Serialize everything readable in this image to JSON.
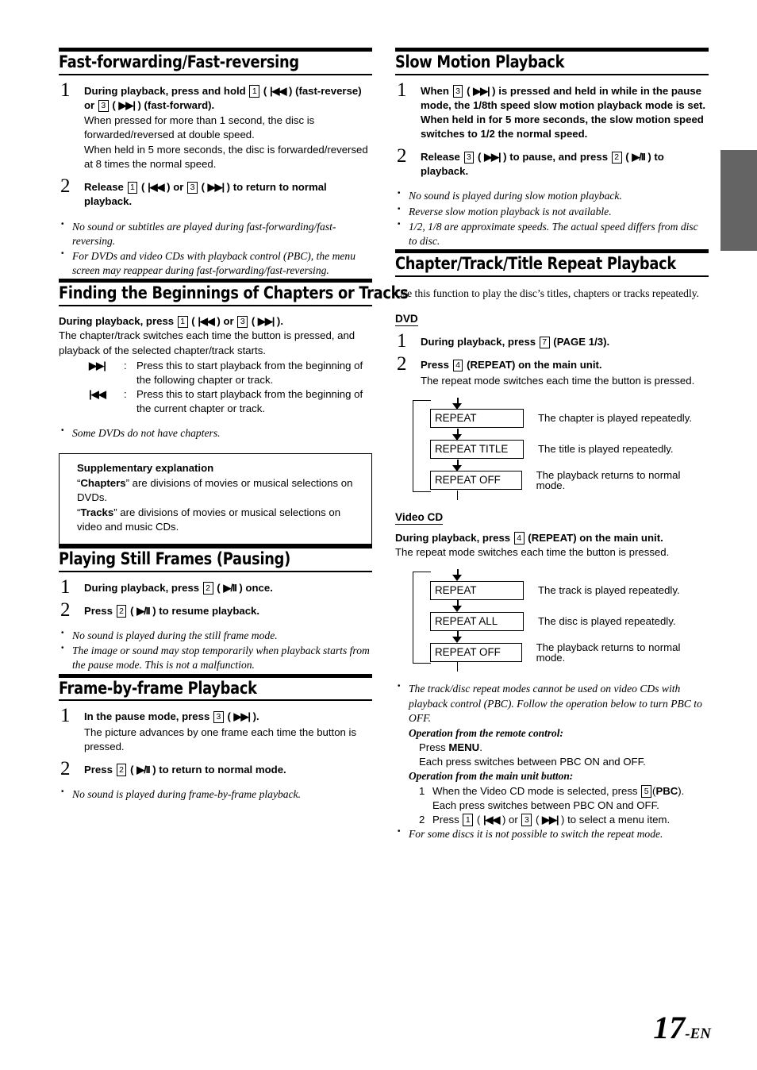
{
  "page": {
    "number_main": "17",
    "number_suffix": "-EN",
    "thumb_tab_color": "#646464"
  },
  "symbols": {
    "prev": "|◀◀",
    "next": "▶▶|",
    "play_pause": "▶/II"
  },
  "left_column": {
    "sections": [
      {
        "id": "fast-forwarding",
        "title": "Fast-forwarding/Fast-reversing",
        "steps": [
          {
            "num": "1",
            "lead_parts": [
              {
                "t": "text",
                "v": "During playback, press and hold "
              },
              {
                "t": "key",
                "v": "1"
              },
              {
                "t": "text",
                "v": " ( "
              },
              {
                "t": "sym",
                "v": "|◀◀"
              },
              {
                "t": "text",
                "v": " ) (fast-reverse) or "
              },
              {
                "t": "key",
                "v": "3"
              },
              {
                "t": "text",
                "v": " ( "
              },
              {
                "t": "sym",
                "v": "▶▶|"
              },
              {
                "t": "text",
                "v": " ) (fast-forward)."
              }
            ],
            "sub": [
              "When pressed for more than 1 second, the disc is forwarded/reversed at double speed.",
              "When held in 5 more seconds, the disc is forwarded/reversed at 8 times the normal speed."
            ]
          },
          {
            "num": "2",
            "lead_parts": [
              {
                "t": "text",
                "v": "Release "
              },
              {
                "t": "key",
                "v": "1"
              },
              {
                "t": "text",
                "v": " ( "
              },
              {
                "t": "sym",
                "v": "|◀◀"
              },
              {
                "t": "text",
                "v": " ) or "
              },
              {
                "t": "key",
                "v": "3"
              },
              {
                "t": "text",
                "v": " ( "
              },
              {
                "t": "sym",
                "v": "▶▶|"
              },
              {
                "t": "text",
                "v": " ) to return to normal playback."
              }
            ],
            "sub": []
          }
        ],
        "notes": [
          "No sound or subtitles are played during fast-forwarding/fast-reversing.",
          "For DVDs and video CDs with playback control (PBC), the menu screen may reappear during fast-forwarding/fast-reversing."
        ]
      },
      {
        "id": "finding-beginnings",
        "title": "Finding the Beginnings of Chapters or Tracks",
        "instruction_parts": [
          {
            "t": "text",
            "v": "During playback, press "
          },
          {
            "t": "key",
            "v": "1"
          },
          {
            "t": "text",
            "v": " ( "
          },
          {
            "t": "sym",
            "v": "|◀◀"
          },
          {
            "t": "text",
            "v": " ) or "
          },
          {
            "t": "key",
            "v": "3"
          },
          {
            "t": "text",
            "v": " ( "
          },
          {
            "t": "sym",
            "v": "▶▶|"
          },
          {
            "t": "text",
            "v": " )."
          }
        ],
        "body": "The chapter/track switches each time the button is pressed, and playback of the selected chapter/track starts.",
        "symbol_rows": [
          {
            "symbol": "▶▶|",
            "desc": "Press this to start playback from the beginning of the following chapter or track."
          },
          {
            "symbol": "|◀◀",
            "desc": "Press this to start playback from the beginning of the current chapter or track."
          }
        ],
        "notes": [
          "Some DVDs do not have chapters."
        ],
        "supplementary": {
          "title": "Supplementary explanation",
          "lines": [
            [
              {
                "t": "text",
                "v": "“"
              },
              {
                "t": "b",
                "v": "Chapters"
              },
              {
                "t": "text",
                "v": "” are divisions of movies or musical selections on DVDs."
              }
            ],
            [
              {
                "t": "text",
                "v": "“"
              },
              {
                "t": "b",
                "v": "Tracks"
              },
              {
                "t": "text",
                "v": "” are divisions of movies or musical selections on video and music CDs."
              }
            ]
          ]
        }
      },
      {
        "id": "still-frames",
        "title": "Playing Still Frames (Pausing)",
        "steps": [
          {
            "num": "1",
            "lead_parts": [
              {
                "t": "text",
                "v": "During playback, press "
              },
              {
                "t": "key",
                "v": "2"
              },
              {
                "t": "text",
                "v": " ( "
              },
              {
                "t": "sym",
                "v": "▶/II"
              },
              {
                "t": "text",
                "v": " ) once."
              }
            ],
            "sub": []
          },
          {
            "num": "2",
            "lead_parts": [
              {
                "t": "text",
                "v": "Press "
              },
              {
                "t": "key",
                "v": "2"
              },
              {
                "t": "text",
                "v": " ( "
              },
              {
                "t": "sym",
                "v": "▶/II"
              },
              {
                "t": "text",
                "v": " ) to resume playback."
              }
            ],
            "sub": []
          }
        ],
        "notes": [
          "No sound is played during the still frame mode.",
          "The image or sound may stop temporarily when playback starts from the pause mode. This is not a malfunction."
        ]
      },
      {
        "id": "frame-by-frame",
        "title": "Frame-by-frame Playback",
        "steps": [
          {
            "num": "1",
            "lead_parts": [
              {
                "t": "text",
                "v": "In the pause mode, press "
              },
              {
                "t": "key",
                "v": "3"
              },
              {
                "t": "text",
                "v": " ( "
              },
              {
                "t": "sym",
                "v": "▶▶|"
              },
              {
                "t": "text",
                "v": " )."
              }
            ],
            "sub": [
              "The picture advances by one frame each time the button is pressed."
            ]
          },
          {
            "num": "2",
            "lead_parts": [
              {
                "t": "text",
                "v": "Press "
              },
              {
                "t": "key",
                "v": "2"
              },
              {
                "t": "text",
                "v": " ( "
              },
              {
                "t": "sym",
                "v": "▶/II"
              },
              {
                "t": "text",
                "v": " ) to return to normal mode."
              }
            ],
            "sub": []
          }
        ],
        "notes": [
          "No sound is played during frame-by-frame playback."
        ]
      }
    ]
  },
  "right_column": {
    "sections": [
      {
        "id": "slow-motion",
        "title": "Slow Motion Playback",
        "steps": [
          {
            "num": "1",
            "lead_parts": [
              {
                "t": "text",
                "v": "When "
              },
              {
                "t": "key",
                "v": "3"
              },
              {
                "t": "text",
                "v": " ( "
              },
              {
                "t": "sym",
                "v": "▶▶|"
              },
              {
                "t": "text",
                "v": " ) is pressed and held in while in the pause mode, the 1/8th speed slow motion playback mode is set."
              }
            ],
            "lead_extra": "When held in for 5 more seconds, the slow motion speed switches to 1/2 the normal speed.",
            "sub": []
          },
          {
            "num": "2",
            "lead_parts": [
              {
                "t": "text",
                "v": "Release "
              },
              {
                "t": "key",
                "v": "3"
              },
              {
                "t": "text",
                "v": " ( "
              },
              {
                "t": "sym",
                "v": "▶▶|"
              },
              {
                "t": "text",
                "v": " ) to pause, and press "
              },
              {
                "t": "key",
                "v": "2"
              },
              {
                "t": "text",
                "v": " ( "
              },
              {
                "t": "sym",
                "v": "▶/II"
              },
              {
                "t": "text",
                "v": " ) to playback."
              }
            ],
            "sub": []
          }
        ],
        "notes": [
          "No sound is played during slow motion playback.",
          "Reverse slow motion playback is not available.",
          "1/2, 1/8 are approximate speeds. The actual speed differs from disc to disc."
        ]
      },
      {
        "id": "repeat-playback",
        "title": "Chapter/Track/Title Repeat Playback",
        "intro": "Use this function to play the disc’s titles, chapters or tracks repeatedly.",
        "dvd": {
          "label": "DVD",
          "steps": [
            {
              "num": "1",
              "lead_parts": [
                {
                  "t": "text",
                  "v": "During playback, press "
                },
                {
                  "t": "key",
                  "v": "7"
                },
                {
                  "t": "text",
                  "v": " ("
                },
                {
                  "t": "b",
                  "v": "PAGE 1/3"
                },
                {
                  "t": "text",
                  "v": ")."
                }
              ],
              "sub": []
            },
            {
              "num": "2",
              "lead_parts": [
                {
                  "t": "text",
                  "v": "Press "
                },
                {
                  "t": "key",
                  "v": "4"
                },
                {
                  "t": "text",
                  "v": " ("
                },
                {
                  "t": "b",
                  "v": "REPEAT"
                },
                {
                  "t": "text",
                  "v": ") on the main unit."
                }
              ],
              "sub": [
                "The repeat mode switches each time the button is pressed."
              ]
            }
          ],
          "flow": [
            {
              "box": "REPEAT",
              "desc": "The chapter is played repeatedly."
            },
            {
              "box": "REPEAT TITLE",
              "desc": "The title is played repeatedly."
            },
            {
              "box": "REPEAT OFF",
              "desc": "The playback returns to normal mode."
            }
          ]
        },
        "videocd": {
          "label": "Video CD",
          "instruction_parts": [
            {
              "t": "text",
              "v": "During playback, press "
            },
            {
              "t": "key",
              "v": "4"
            },
            {
              "t": "text",
              "v": " ("
            },
            {
              "t": "b",
              "v": "REPEAT"
            },
            {
              "t": "text",
              "v": ") on the main unit."
            }
          ],
          "body": "The repeat mode switches each time the button is pressed.",
          "flow": [
            {
              "box": "REPEAT",
              "desc": "The track is played repeatedly."
            },
            {
              "box": "REPEAT ALL",
              "desc": "The disc is played repeatedly."
            },
            {
              "box": "REPEAT OFF",
              "desc": "The playback returns to normal mode."
            }
          ]
        },
        "final_notes": {
          "note1": "The track/disc repeat modes cannot be used on video CDs with playback control (PBC). Follow the operation below to turn PBC to OFF.",
          "op_remote_head": "Operation from the remote control:",
          "op_remote_line1_parts": [
            {
              "t": "text",
              "v": "Press "
            },
            {
              "t": "b",
              "v": "MENU"
            },
            {
              "t": "text",
              "v": "."
            }
          ],
          "op_remote_line2": "Each press switches between PBC ON and OFF.",
          "op_unit_head": "Operation from the main unit button:",
          "op_unit_items": [
            {
              "n": "1",
              "parts": [
                {
                  "t": "text",
                  "v": "When the Video CD mode is selected, press "
                },
                {
                  "t": "key",
                  "v": "5"
                },
                {
                  "t": "text",
                  "v": "("
                },
                {
                  "t": "b",
                  "v": "PBC"
                },
                {
                  "t": "text",
                  "v": ")."
                }
              ],
              "cont": "Each press switches between PBC ON and OFF."
            },
            {
              "n": "2",
              "parts": [
                {
                  "t": "text",
                  "v": "Press "
                },
                {
                  "t": "key",
                  "v": "1"
                },
                {
                  "t": "text",
                  "v": " ( "
                },
                {
                  "t": "sym",
                  "v": "|◀◀"
                },
                {
                  "t": "text",
                  "v": " ) or "
                },
                {
                  "t": "key",
                  "v": "3"
                },
                {
                  "t": "text",
                  "v": " ( "
                },
                {
                  "t": "sym",
                  "v": "▶▶|"
                },
                {
                  "t": "text",
                  "v": " ) to select a menu item."
                }
              ],
              "cont": ""
            }
          ],
          "note2": "For some discs it is not possible to switch the repeat mode."
        }
      }
    ]
  }
}
